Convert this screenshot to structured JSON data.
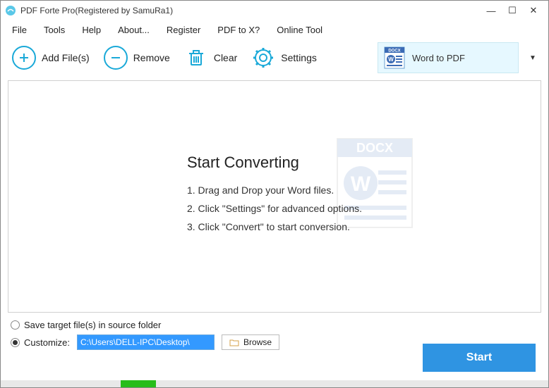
{
  "window": {
    "title": "PDF Forte Pro(Registered by SamuRa1)"
  },
  "menu": {
    "file": "File",
    "tools": "Tools",
    "help": "Help",
    "about": "About...",
    "register": "Register",
    "pdf_to_x": "PDF to X?",
    "online_tool": "Online Tool"
  },
  "toolbar": {
    "add": "Add File(s)",
    "remove": "Remove",
    "clear": "Clear",
    "settings": "Settings"
  },
  "mode": {
    "label": "Word to PDF"
  },
  "main": {
    "heading": "Start Converting",
    "step1": "1. Drag and Drop your Word files.",
    "step2": "2. Click \"Settings\" for advanced options.",
    "step3": "3. Click \"Convert\" to start conversion."
  },
  "output": {
    "save_source": "Save target file(s) in source folder",
    "customize": "Customize:",
    "path": "C:\\Users\\DELL-IPC\\Desktop\\",
    "browse": "Browse"
  },
  "actions": {
    "start": "Start"
  },
  "watermark_label": "DOCX"
}
